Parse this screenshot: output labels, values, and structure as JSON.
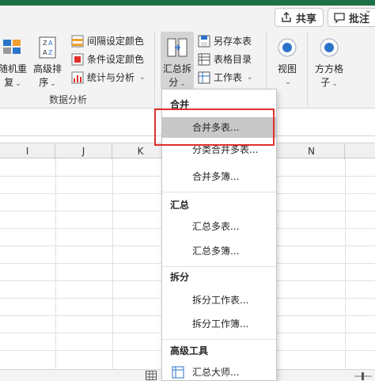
{
  "colors": {
    "accent_green": "#1e7145",
    "highlight_red": "#e0302a",
    "icon_blue": "#2b73c9"
  },
  "topbar": {
    "share_label": "共享",
    "comment_label": "批注"
  },
  "ribbon": {
    "random_label_1": "随机重",
    "random_label_2": "复",
    "sort_label_1": "高级排",
    "sort_label_2": "序",
    "interval_color": "间隔设定颜色",
    "condition_color": "条件设定颜色",
    "stats_analysis": "统计与分析",
    "group_label": "数据分析",
    "summary_split_1": "汇总拆",
    "summary_split_2": "分",
    "save_as_table": "另存本表",
    "table_directory": "表格目录",
    "worksheet": "工作表",
    "view_label": "视图",
    "grid_label_1": "方方格",
    "grid_label_2": "子"
  },
  "columns": [
    "I",
    "J",
    "K",
    "N"
  ],
  "dropdown": {
    "sections": [
      {
        "header": "合并",
        "items": [
          "合并多表...",
          "分类合并多表...",
          "合并多簿..."
        ]
      },
      {
        "header": "汇总",
        "items": [
          "汇总多表...",
          "汇总多簿..."
        ]
      },
      {
        "header": "拆分",
        "items": [
          "拆分工作表...",
          "拆分工作簿..."
        ]
      },
      {
        "header": "高级工具",
        "items": [
          "汇总大师..."
        ]
      }
    ]
  }
}
